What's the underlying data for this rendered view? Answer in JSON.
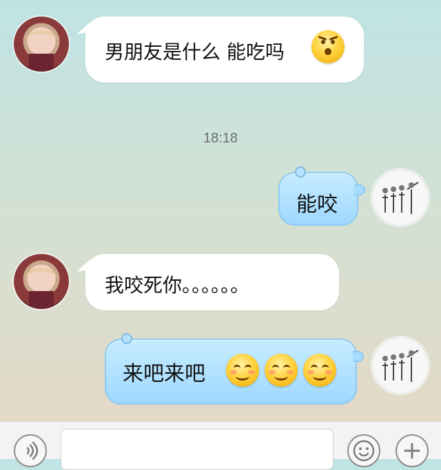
{
  "messages": [
    {
      "side": "left",
      "text": "男朋友是什么 能吃吗",
      "emoji": [
        "shocked-emoji"
      ]
    },
    {
      "side": "right",
      "text": "能咬"
    },
    {
      "side": "left",
      "text": "我咬死你。。。。。。"
    },
    {
      "side": "right",
      "text": "来吧来吧",
      "emoji": [
        "smile-emoji",
        "smile-emoji",
        "smile-emoji"
      ]
    }
  ],
  "time_separator": "18:18",
  "toolbar": {
    "left_icon": "voice-icon",
    "right_icons": [
      "emoji-icon",
      "plus-icon"
    ]
  }
}
